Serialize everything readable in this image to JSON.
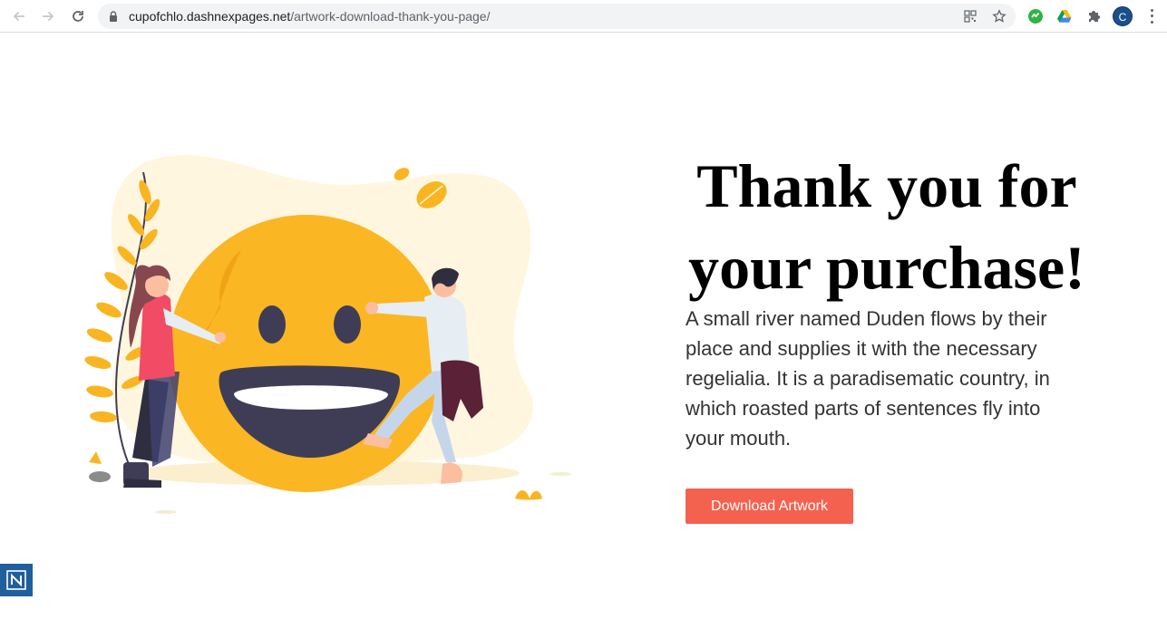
{
  "browser": {
    "url_host": "cupofchlo.dashnexpages.net",
    "url_path": "/artwork-download-thank-you-page/",
    "profile_initial": "C"
  },
  "page": {
    "title": "Thank you for your purchase!",
    "body": "A small river named Duden flows by their place and supplies it with the necessary regelialia. It is a paradisematic country, in which roasted parts of sentences fly into your mouth.",
    "button_label": "Download Artwork"
  },
  "colors": {
    "accent": "#f4624f",
    "smiley": "#fbb623",
    "blob": "#fff6df"
  },
  "icons": [
    "back-arrow-icon",
    "forward-arrow-icon",
    "reload-icon",
    "lock-icon",
    "qr-code-icon",
    "star-icon",
    "extension-refresh-icon",
    "google-drive-icon",
    "puzzle-icon",
    "menu-icon",
    "badge-icon"
  ]
}
